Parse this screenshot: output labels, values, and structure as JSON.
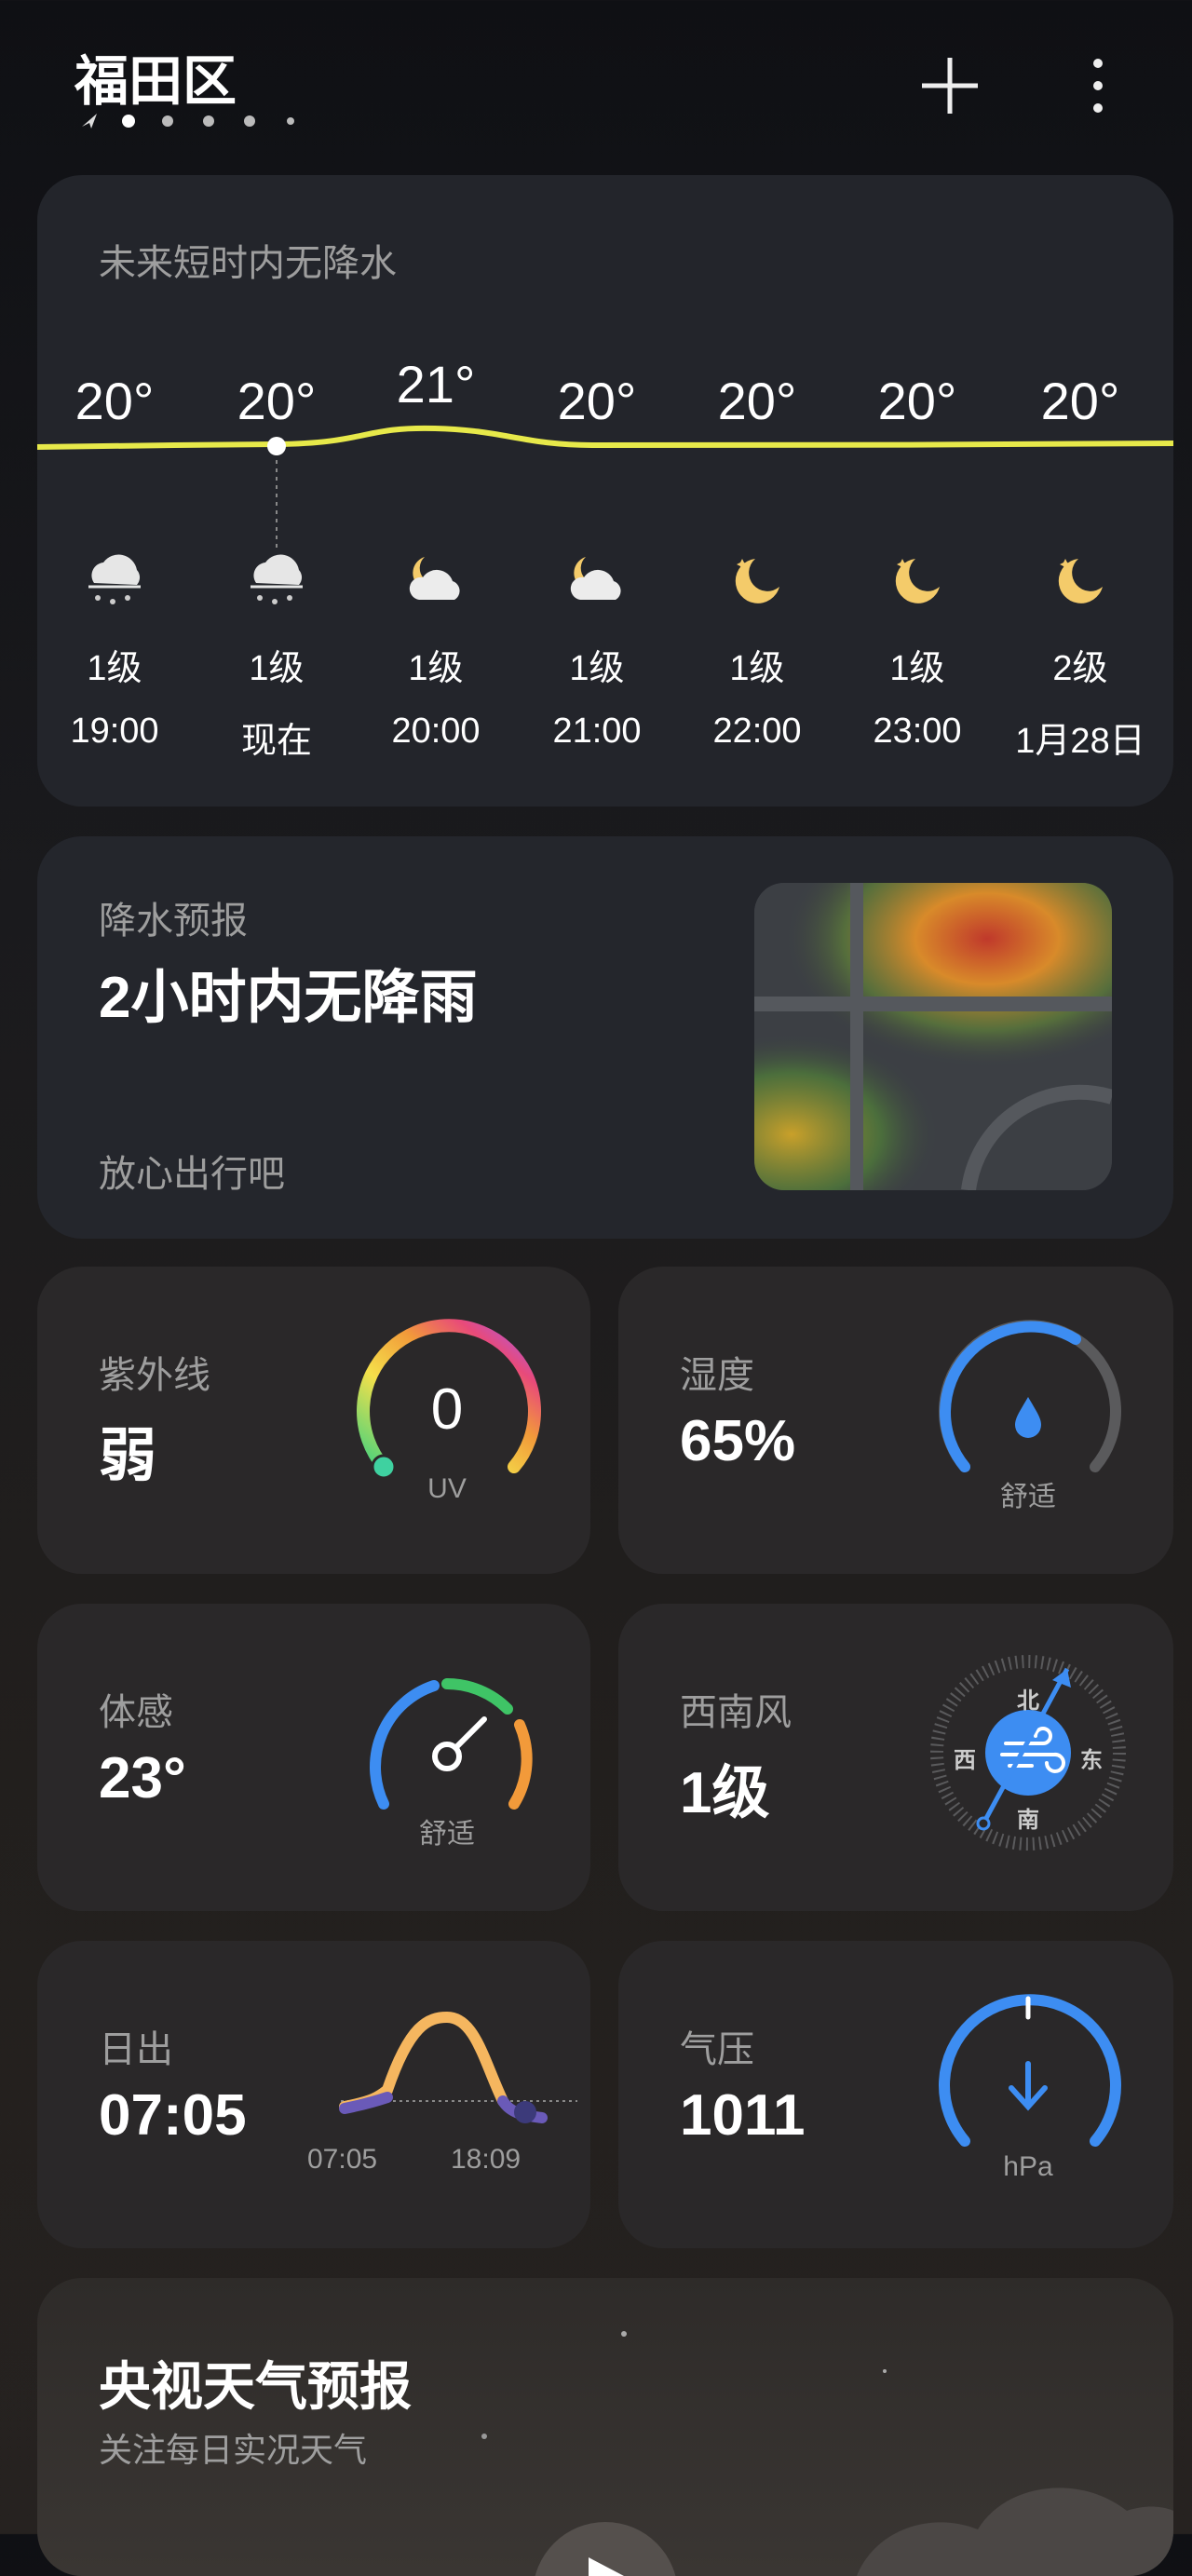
{
  "header": {
    "location": "福田区",
    "add_icon": "plus-icon",
    "menu_icon": "more-vertical-icon"
  },
  "hourly": {
    "summary": "未来短时内无降水",
    "items": [
      {
        "temp": "20°",
        "wind": "1级",
        "time": "19:00",
        "icon": "rain-icon"
      },
      {
        "temp": "20°",
        "wind": "1级",
        "time": "现在",
        "icon": "rain-icon"
      },
      {
        "temp": "21°",
        "wind": "1级",
        "time": "20:00",
        "icon": "moon-cloud-icon"
      },
      {
        "temp": "20°",
        "wind": "1级",
        "time": "21:00",
        "icon": "moon-cloud-icon"
      },
      {
        "temp": "20°",
        "wind": "1级",
        "time": "22:00",
        "icon": "moon-icon"
      },
      {
        "temp": "20°",
        "wind": "1级",
        "time": "23:00",
        "icon": "moon-icon"
      },
      {
        "temp": "20°",
        "wind": "2级",
        "time": "1月28日",
        "icon": "moon-icon"
      }
    ]
  },
  "precip": {
    "label": "降水预报",
    "value": "2小时内无降雨",
    "note": "放心出行吧"
  },
  "uv": {
    "label": "紫外线",
    "value": "弱",
    "index": "0",
    "unit": "UV"
  },
  "humidity": {
    "label": "湿度",
    "value": "65%",
    "status": "舒适"
  },
  "feels": {
    "label": "体感",
    "value": "23°",
    "status": "舒适"
  },
  "wind": {
    "label": "西南风",
    "value": "1级",
    "n": "北",
    "s": "南",
    "e": "东",
    "w": "西"
  },
  "sun": {
    "label": "日出",
    "value": "07:05",
    "rise": "07:05",
    "set": "18:09"
  },
  "pressure": {
    "label": "气压",
    "value": "1011",
    "unit": "hPa"
  },
  "video": {
    "title": "央视天气预报",
    "subtitle": "关注每日实况天气"
  }
}
